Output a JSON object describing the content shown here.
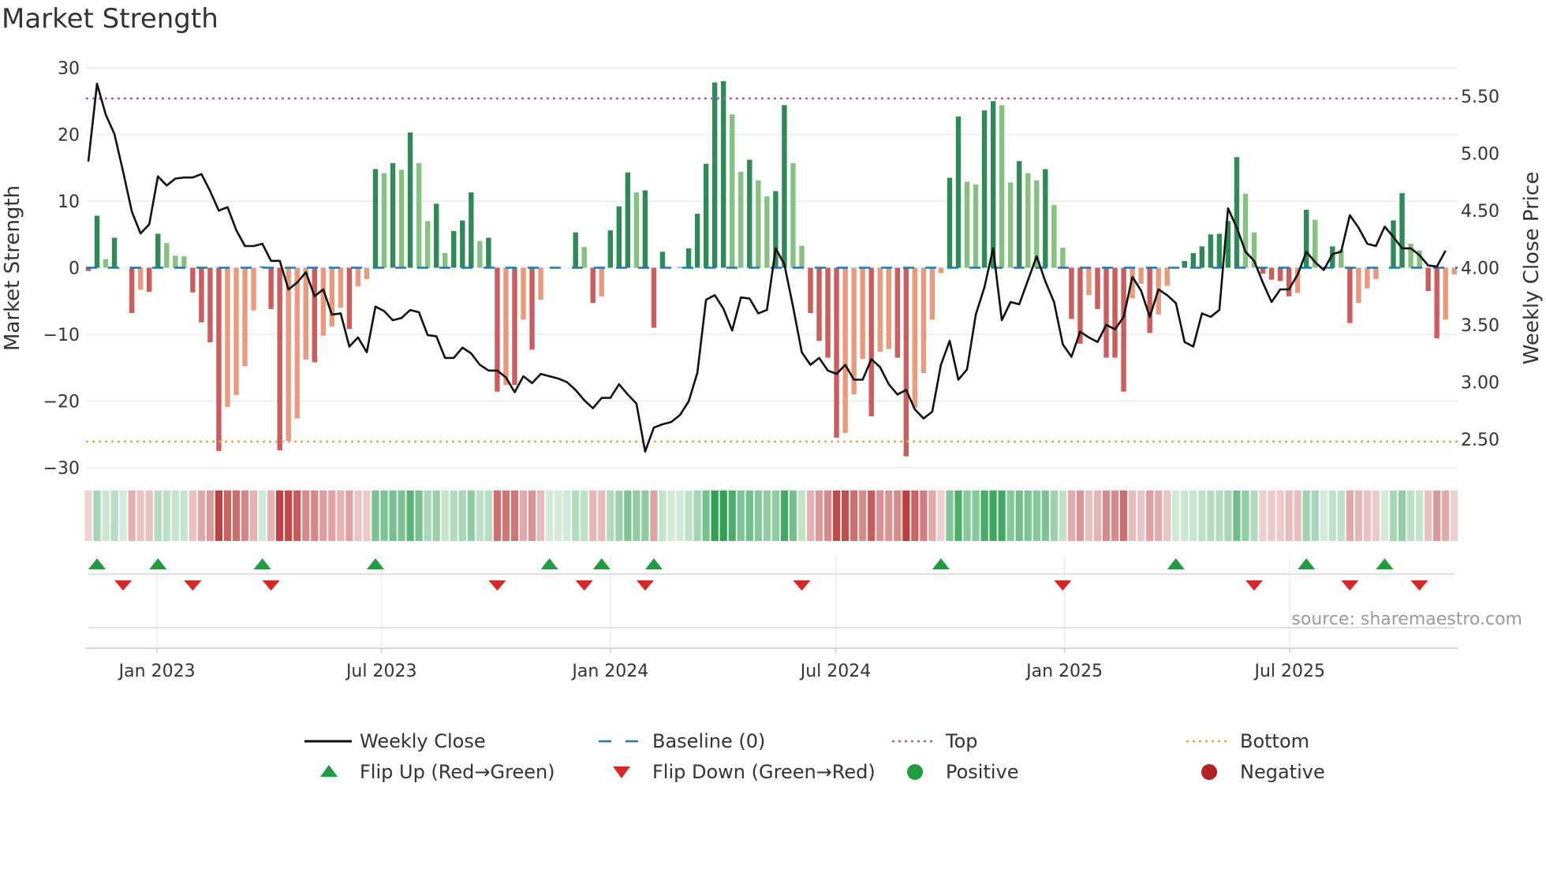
{
  "chart_data": {
    "type": "bar",
    "title": "Market Strength",
    "ylabel": "Market Strength",
    "y2label": "Weekly Close Price",
    "ylim": [
      -30,
      30
    ],
    "y2lim": [
      2.25,
      5.75
    ],
    "yticks": [
      {
        "v": 30,
        "label": "30"
      },
      {
        "v": 20,
        "label": "20"
      },
      {
        "v": 10,
        "label": "10"
      },
      {
        "v": 0,
        "label": "0"
      },
      {
        "v": -10,
        "label": "−10"
      },
      {
        "v": -20,
        "label": "−20"
      },
      {
        "v": -30,
        "label": "−30"
      }
    ],
    "y2ticks": [
      {
        "v": 5.5,
        "label": "5.50"
      },
      {
        "v": 5.0,
        "label": "5.00"
      },
      {
        "v": 4.5,
        "label": "4.50"
      },
      {
        "v": 4.0,
        "label": "4.00"
      },
      {
        "v": 3.5,
        "label": "3.50"
      },
      {
        "v": 3.0,
        "label": "3.00"
      },
      {
        "v": 2.5,
        "label": "2.50"
      }
    ],
    "xticks": [
      {
        "week": 7.9,
        "label": "Jan 2023"
      },
      {
        "week": 33.7,
        "label": "Jul 2023"
      },
      {
        "week": 60.0,
        "label": "Jan 2024"
      },
      {
        "week": 85.9,
        "label": "Jul 2024"
      },
      {
        "week": 112.2,
        "label": "Jan 2025"
      },
      {
        "week": 138.1,
        "label": "Jul 2025"
      }
    ],
    "top_level": 25.4,
    "bottom_level": -26.1,
    "baseline": 0,
    "strength": [
      -0.5,
      7.8,
      1.3,
      4.5,
      0,
      -6.8,
      -3.3,
      -3.6,
      5.1,
      3.7,
      1.8,
      1.7,
      -3.7,
      -8.2,
      -11.2,
      -27.5,
      -20.9,
      -19.1,
      -14.8,
      -6.4,
      0.2,
      -6.2,
      -27.4,
      -26,
      -22.6,
      -13.8,
      -14.2,
      -10.2,
      -8.8,
      -6,
      -9.2,
      -2.8,
      -1.7,
      14.8,
      14.2,
      15.7,
      14.7,
      20.3,
      15.7,
      7,
      9.6,
      2.2,
      5.5,
      7.1,
      11.3,
      4,
      4.5,
      -18.6,
      -17.6,
      -17.6,
      -7.8,
      -12.3,
      -4.8,
      0,
      0,
      0,
      5.3,
      3.1,
      -5.3,
      -4.3,
      5.6,
      9.2,
      14.3,
      11.3,
      11.6,
      -9,
      2.4,
      0,
      0.1,
      2.9,
      8.1,
      15.6,
      27.8,
      28,
      23,
      14.4,
      16.2,
      13.1,
      10.7,
      11.5,
      24.4,
      15.7,
      3.3,
      -6.8,
      -11,
      -13.5,
      -25.5,
      -24.8,
      -19,
      -13.7,
      -22.3,
      -12.6,
      -12.2,
      -13.5,
      -28.3,
      -21,
      -15.8,
      -7.8,
      -0.8,
      13.5,
      22.7,
      12.9,
      12.5,
      23.6,
      25,
      24.4,
      12.8,
      16,
      14.2,
      13.1,
      14.8,
      9.4,
      3,
      -7.7,
      -11.4,
      -4.1,
      -6.2,
      -13.5,
      -13.5,
      -18.6,
      -4.6,
      -2.4,
      -9.8,
      -7,
      -2.7,
      0,
      1,
      2.2,
      3.2,
      5,
      5.1,
      7,
      16.6,
      11.1,
      5.3,
      -0.9,
      -1.8,
      -2,
      -4.3,
      -3.8,
      8.7,
      7.2,
      0,
      3.2,
      2.7,
      -8.3,
      -5.3,
      -3.1,
      -1.7,
      0,
      7.1,
      11.2,
      3.6,
      2.6,
      -3.5,
      -10.6,
      -7.8,
      -1
    ],
    "weekly_close": [
      4.93,
      5.61,
      5.34,
      5.17,
      4.84,
      4.49,
      4.3,
      4.38,
      4.8,
      4.72,
      4.78,
      4.79,
      4.79,
      4.82,
      4.67,
      4.5,
      4.53,
      4.33,
      4.19,
      4.19,
      4.21,
      4.06,
      4.06,
      3.81,
      3.87,
      3.96,
      3.75,
      3.81,
      3.59,
      3.6,
      3.31,
      3.39,
      3.26,
      3.66,
      3.62,
      3.54,
      3.56,
      3.63,
      3.61,
      3.41,
      3.4,
      3.21,
      3.21,
      3.3,
      3.25,
      3.15,
      3.1,
      3.1,
      3.04,
      2.91,
      3.05,
      2.99,
      3.07,
      3.05,
      3.03,
      3.0,
      2.93,
      2.84,
      2.77,
      2.86,
      2.86,
      2.98,
      2.89,
      2.81,
      2.39,
      2.6,
      2.63,
      2.65,
      2.71,
      2.83,
      3.08,
      3.72,
      3.76,
      3.64,
      3.45,
      3.74,
      3.73,
      3.6,
      3.63,
      4.17,
      4.03,
      3.66,
      3.26,
      3.15,
      3.21,
      3.1,
      3.07,
      3.15,
      3.02,
      3.02,
      3.2,
      3.13,
      2.98,
      2.89,
      2.93,
      2.76,
      2.68,
      2.74,
      3.15,
      3.36,
      3.02,
      3.11,
      3.59,
      3.83,
      4.17,
      3.54,
      3.7,
      3.68,
      3.89,
      4.1,
      3.88,
      3.7,
      3.33,
      3.22,
      3.44,
      3.39,
      3.35,
      3.5,
      3.46,
      3.57,
      3.92,
      3.8,
      3.57,
      3.81,
      3.76,
      3.69,
      3.35,
      3.31,
      3.6,
      3.57,
      3.63,
      4.52,
      4.35,
      4.14,
      4.06,
      3.87,
      3.7,
      3.81,
      3.81,
      3.94,
      4.14,
      4.05,
      3.98,
      4.12,
      4.14,
      4.46,
      4.35,
      4.21,
      4.19,
      4.36,
      4.27,
      4.17,
      4.17,
      4.11,
      4.02,
      4.01,
      4.15
    ],
    "flip_up_weeks": [
      1,
      8,
      20,
      33,
      53,
      59,
      65,
      98,
      125,
      140,
      149
    ],
    "flip_down_weeks": [
      4,
      12,
      21,
      47,
      57,
      64,
      82,
      112,
      134,
      145,
      153
    ],
    "colors": {
      "up_strong": "#2e8b57",
      "up_weak": "#86c27f",
      "down_strong": "#cd5c5c",
      "down_weak": "#e99a7c",
      "close": "#111111",
      "baseline": "#1f77b4",
      "top": "#9a5fd8",
      "bottom": "#f0a050",
      "flip_up": "#1e9e3e",
      "flip_down": "#d62728",
      "positive": "#1e9e3e",
      "negative": "#b22222"
    },
    "legend": [
      {
        "key": "close",
        "label": "Weekly Close"
      },
      {
        "key": "baseline",
        "label": "Baseline (0)"
      },
      {
        "key": "top",
        "label": "Top"
      },
      {
        "key": "bottom",
        "label": "Bottom"
      },
      {
        "key": "flip_up",
        "label": "Flip Up (Red→Green)"
      },
      {
        "key": "flip_down",
        "label": "Flip Down (Green→Red)"
      },
      {
        "key": "positive",
        "label": "Positive"
      },
      {
        "key": "negative",
        "label": "Negative"
      }
    ],
    "legend_position": "bottom-center",
    "source": "source: sharemaestro.com"
  }
}
